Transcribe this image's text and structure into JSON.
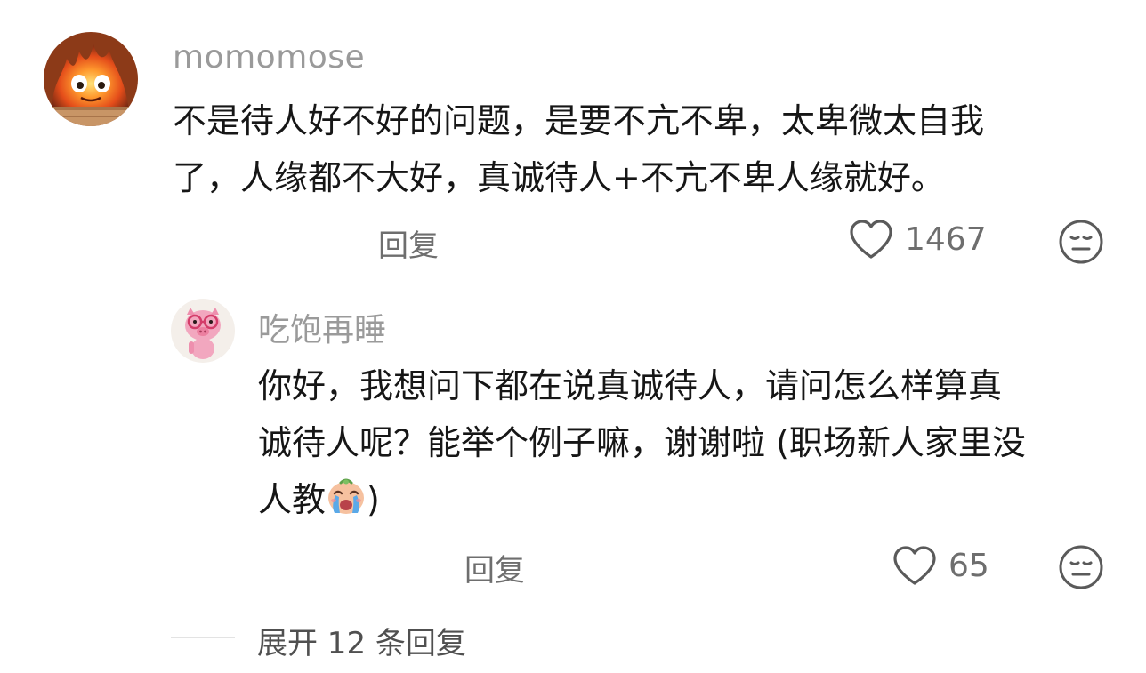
{
  "comment": {
    "avatar_icon": "calcifer-fire-avatar",
    "username": "momomose",
    "content_lines": [
      "不是待人好不好的问题，是要不亢不卑，太卑微太自我",
      "了，人缘都不大好，真诚待人+不亢不卑人缘就好。"
    ],
    "reply_label": "回复",
    "like_count": "1467"
  },
  "reply": {
    "avatar_icon": "pink-pig-avatar",
    "username": "吃饱再睡",
    "content_lines": [
      "你好，我想问下都在说真诚待人，请问怎么样算真",
      "诚待人呢？能举个例子嘛，谢谢啦 (职场新人家里没",
      "人教"
    ],
    "content_tail": ")",
    "emoji": "crying-emoji",
    "reply_label": "回复",
    "like_count": "65"
  },
  "expand_label": "展开 12 条回复",
  "icons": {
    "like": "heart-outline-icon",
    "dislike": "meh-face-icon"
  },
  "colors": {
    "text_primary": "#161616",
    "text_secondary": "#9a9a9a",
    "action_gray": "#6e6e6e",
    "background": "#ffffff"
  }
}
